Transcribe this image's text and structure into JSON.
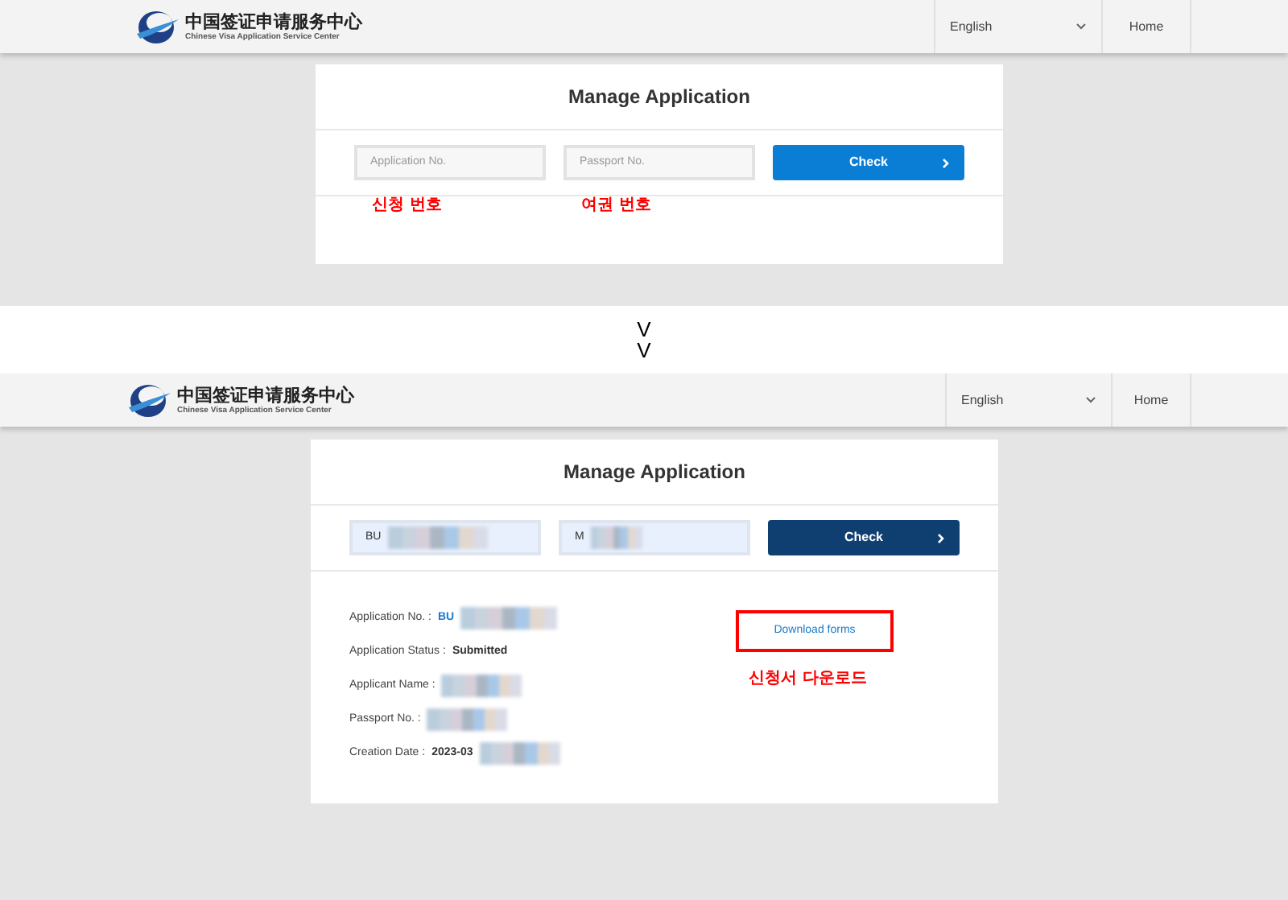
{
  "screens": [
    {
      "header": {
        "logo_title": "中国签证申请服务中心",
        "logo_subtitle": "Chinese Visa Application Service Center",
        "language": "English",
        "nav": [
          "Home"
        ]
      },
      "card": {
        "title": "Manage Application",
        "fields": [
          {
            "placeholder": "Application No.",
            "redacted": false,
            "annotation": "신청 번호"
          },
          {
            "placeholder": "Passport No.",
            "redacted": false,
            "annotation": "여권 번호"
          }
        ],
        "button": {
          "label": "Check",
          "active": false
        }
      }
    },
    {
      "header": {
        "logo_title": "中国签证申请服务中心",
        "logo_subtitle": "Chinese Visa Application Service Center",
        "language": "English",
        "nav": [
          "Home"
        ]
      },
      "card": {
        "title": "Manage Application",
        "fields": [
          {
            "value_prefix": "BU",
            "redacted": true
          },
          {
            "value_prefix": "M",
            "redacted": true
          }
        ],
        "button": {
          "label": "Check",
          "active": true
        },
        "details": [
          {
            "label": "Application No. :",
            "value": "BU",
            "kind": "link",
            "redacted": true
          },
          {
            "label": "Application Status :",
            "value": "Submitted",
            "kind": "bold"
          },
          {
            "label": "Applicant Name :",
            "redacted": true
          },
          {
            "label": "Passport No. :",
            "redacted": true
          },
          {
            "label": "Creation Date :",
            "value": "2023-03",
            "kind": "bold",
            "redacted": true
          }
        ],
        "download": {
          "label": "Download forms",
          "highlighted": true,
          "annotation": "신청서 다운로드"
        }
      }
    }
  ],
  "separator": [
    "V",
    "V"
  ]
}
